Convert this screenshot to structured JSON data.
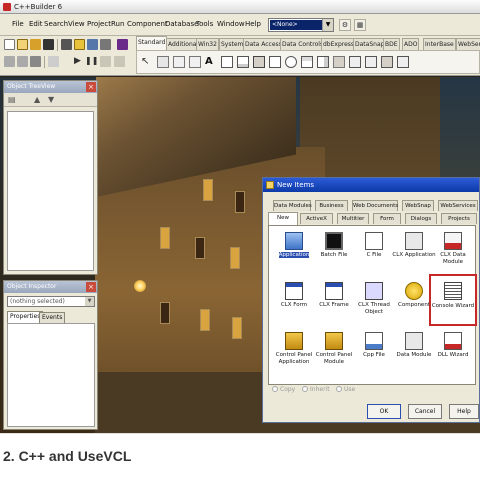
{
  "window": {
    "title": "C++Builder 6"
  },
  "menubar": {
    "items": [
      "File",
      "Edit",
      "Search",
      "View",
      "Project",
      "Run",
      "Component",
      "Database",
      "Tools",
      "Window",
      "Help"
    ],
    "desktop_combo_value": "<None>"
  },
  "palette": {
    "tabs": [
      "Standard",
      "Additional",
      "Win32",
      "System",
      "Data Access",
      "Data Controls",
      "dbExpress",
      "DataSnap",
      "BDE",
      "ADO",
      "InterBase",
      "WebSer"
    ],
    "active_tab": "Standard"
  },
  "treeview": {
    "title": "Object TreeView"
  },
  "inspector": {
    "title": "Object Inspector",
    "selection": "(nothing selected)",
    "tabs": [
      "Properties",
      "Events"
    ]
  },
  "dialog": {
    "title": "New Items",
    "tabs_row1": [
      "Data Modules",
      "Business",
      "Web Documents",
      "WebSnap",
      "WebServices"
    ],
    "tabs_row2": [
      "New",
      "ActiveX",
      "Multitier",
      "Form",
      "Dialogs",
      "Projects"
    ],
    "active_tab": "New",
    "items": [
      {
        "label": "Application",
        "icon": "application-icon"
      },
      {
        "label": "Batch File",
        "icon": "batch-file-icon"
      },
      {
        "label": "C File",
        "icon": "c-file-icon"
      },
      {
        "label": "CLX Application",
        "icon": "clx-application-icon"
      },
      {
        "label": "CLX Data Module",
        "icon": "clx-data-module-icon"
      },
      {
        "label": "CLX Form",
        "icon": "clx-form-icon"
      },
      {
        "label": "CLX Frame",
        "icon": "clx-frame-icon"
      },
      {
        "label": "CLX Thread Object",
        "icon": "clx-thread-icon"
      },
      {
        "label": "Component",
        "icon": "component-icon"
      },
      {
        "label": "Console Wizard",
        "icon": "console-wizard-icon"
      },
      {
        "label": "Control Panel Application",
        "icon": "control-panel-app-icon"
      },
      {
        "label": "Control Panel Module",
        "icon": "control-panel-module-icon"
      },
      {
        "label": "Cpp File",
        "icon": "cpp-file-icon"
      },
      {
        "label": "Data Module",
        "icon": "data-module-icon"
      },
      {
        "label": "DLL Wizard",
        "icon": "dll-wizard-icon"
      }
    ],
    "radio_options": [
      "Copy",
      "Inherit",
      "Use"
    ],
    "buttons": {
      "ok": "OK",
      "cancel": "Cancel",
      "help": "Help"
    },
    "highlight_color": "#c62828"
  },
  "caption": "2. C++ and UseVCL"
}
